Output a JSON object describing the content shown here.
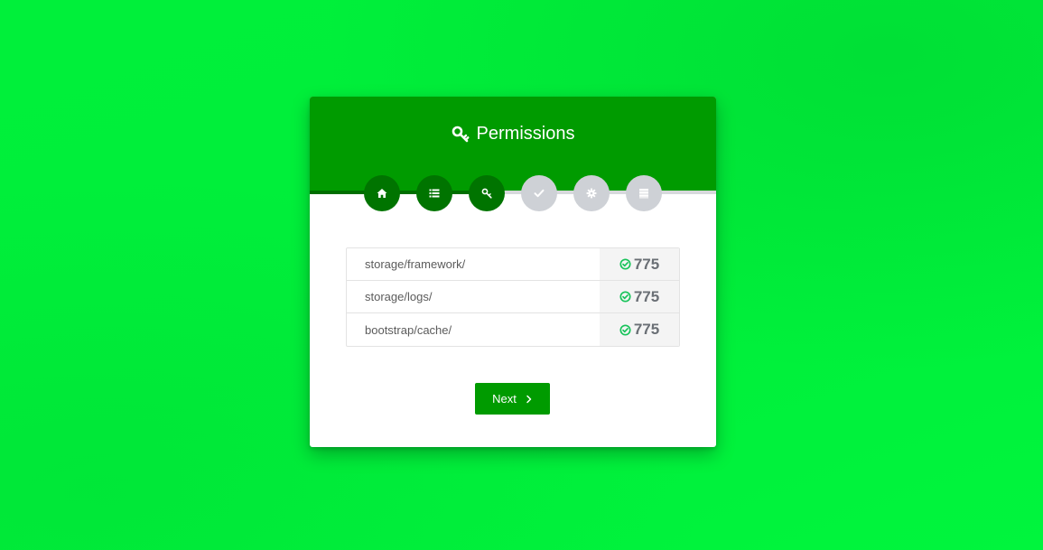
{
  "header": {
    "title": "Permissions",
    "title_icon": "key-icon"
  },
  "colors": {
    "background": "#00f23a",
    "header": "#009b00",
    "step_done": "#007400",
    "step_pending": "#ced1d6",
    "status_ok": "#17c35a",
    "button": "#009b00"
  },
  "steps": [
    {
      "icon": "home-icon",
      "state": "done"
    },
    {
      "icon": "list-icon",
      "state": "done"
    },
    {
      "icon": "key-icon",
      "state": "done"
    },
    {
      "icon": "check-icon",
      "state": "pending"
    },
    {
      "icon": "gear-icon",
      "state": "pending"
    },
    {
      "icon": "server-icon",
      "state": "pending"
    }
  ],
  "permissions": [
    {
      "path": "storage/framework/",
      "value": "775",
      "status_icon": "check-circle-icon"
    },
    {
      "path": "storage/logs/",
      "value": "775",
      "status_icon": "check-circle-icon"
    },
    {
      "path": "bootstrap/cache/",
      "value": "775",
      "status_icon": "check-circle-icon"
    }
  ],
  "next_button": {
    "label": "Next",
    "icon": "chevron-right-icon"
  }
}
